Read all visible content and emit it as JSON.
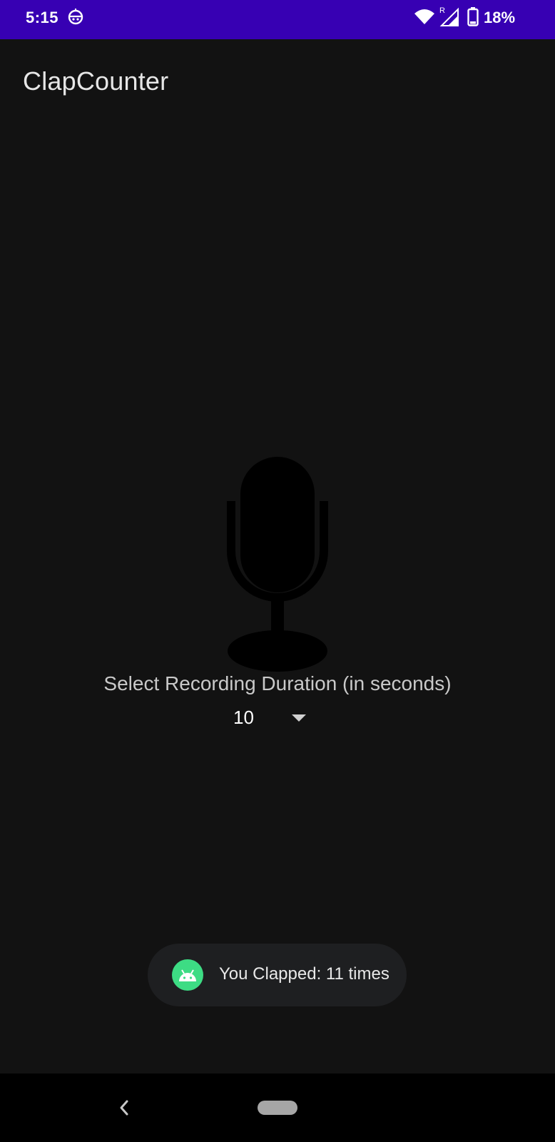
{
  "status_bar": {
    "time": "5:15",
    "battery_percent": "18%",
    "signal_badge": "R",
    "notification_icon": "robot-face-icon",
    "colors": {
      "background": "#3700b3",
      "foreground": "#ffffff"
    }
  },
  "app": {
    "title": "ClapCounter",
    "background_color": "#121212"
  },
  "main": {
    "mic_icon": "microphone-icon",
    "duration_label": "Select Recording Duration (in seconds)",
    "duration_selected": "10"
  },
  "toast": {
    "message": "You Clapped: 11 times",
    "icon": "android-icon",
    "icon_color": "#3ddc84"
  },
  "nav_bar": {
    "back_icon": "back-chevron-icon",
    "home_icon": "home-pill-icon"
  }
}
